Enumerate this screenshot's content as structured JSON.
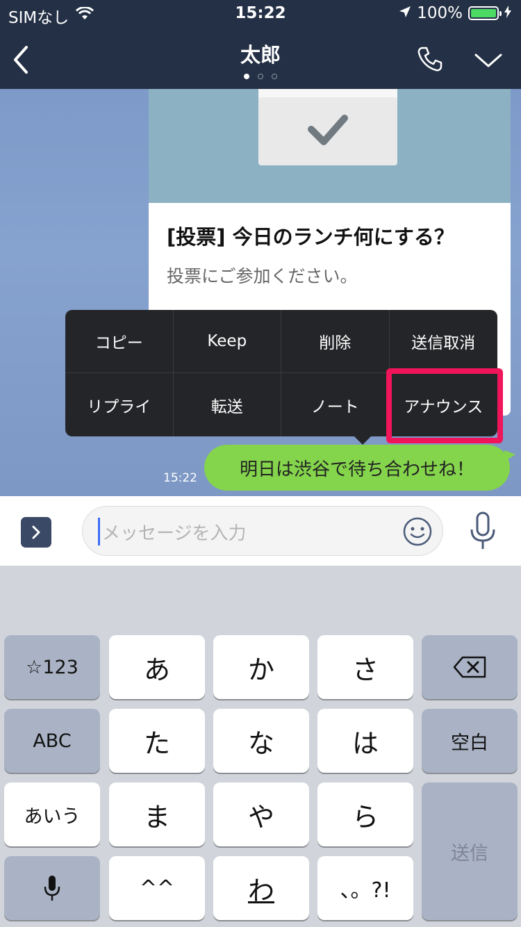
{
  "status_bar": {
    "carrier": "SIMなし",
    "time": "15:22",
    "battery": "100%",
    "battery_color": "#4cd964"
  },
  "header": {
    "title": "太郎",
    "back_icon": "chevron-left-icon",
    "call_icon": "phone-icon",
    "menu_icon": "chevron-down-icon",
    "pages": 3,
    "active_page": 1
  },
  "poll_card": {
    "title": "[投票] 今日のランチ何にする？",
    "subtitle": "投票にご参加ください。"
  },
  "context_menu": {
    "items": [
      "コピー",
      "Keep",
      "削除",
      "送信取消",
      "リプライ",
      "転送",
      "ノート",
      "アナウンス"
    ],
    "highlighted": "アナウンス",
    "highlight_color": "#f0145a"
  },
  "message": {
    "text": "明日は渋谷で待ち合わせね！",
    "time": "15:22",
    "bubble_color": "#84d44c"
  },
  "input_bar": {
    "placeholder": "メッセージを入力"
  },
  "keyboard": {
    "left_col": [
      "☆123",
      "ABC",
      "あいう"
    ],
    "rows": [
      [
        "あ",
        "か",
        "さ"
      ],
      [
        "た",
        "な",
        "は"
      ],
      [
        "ま",
        "や",
        "ら"
      ],
      [
        "^^",
        "わ",
        "、。?!"
      ]
    ],
    "space": "空白",
    "send": "送信"
  }
}
